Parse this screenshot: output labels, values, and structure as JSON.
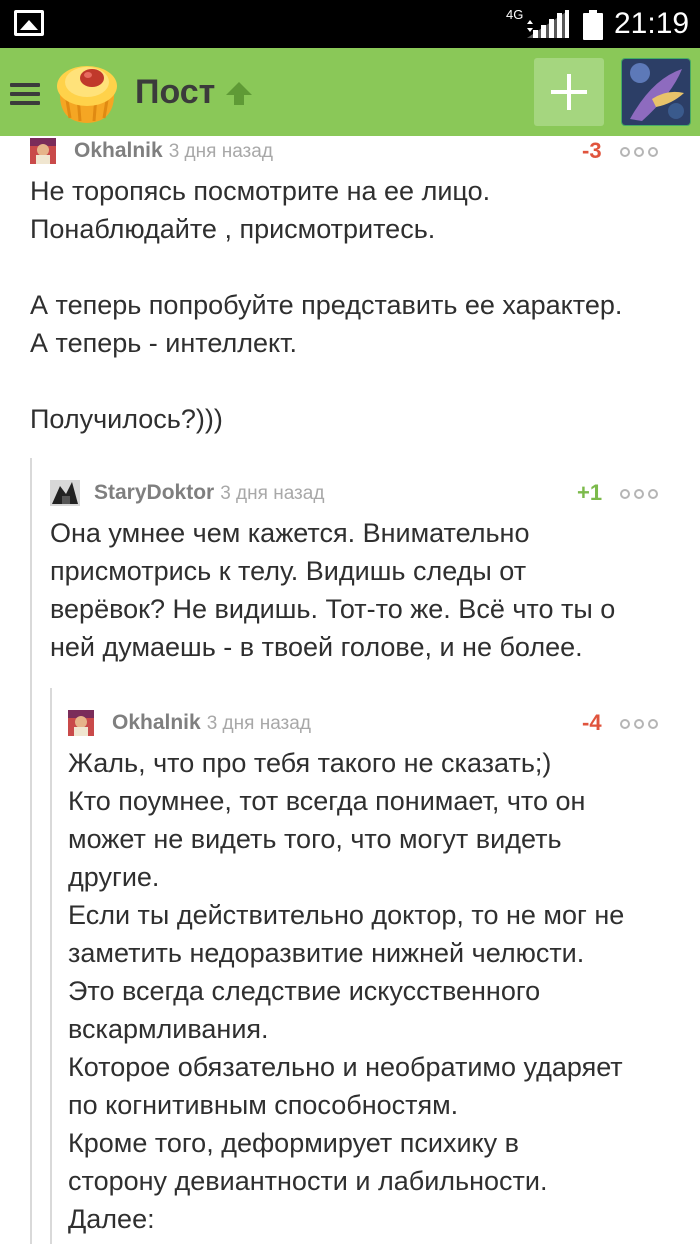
{
  "status_bar": {
    "network": "4G",
    "time": "21:19"
  },
  "app_bar": {
    "title": "Пост",
    "colors": {
      "bar": "#8ac858",
      "title": "#3b3b3b"
    },
    "icons": [
      "menu-icon",
      "logo-icon",
      "arrow-up-icon",
      "plus-icon",
      "user-avatar"
    ]
  },
  "comments": [
    {
      "author": "Okhalnik",
      "time": "3 дня назад",
      "rating": "-3",
      "text": "Не торопясь посмотрите на ее лицо.\nПонаблюдайте , присмотритесь.\n\nА теперь попробуйте представить ее характер.\nА теперь - интеллект.\n\nПолучилось?)))"
    },
    {
      "author": "StaryDoktor",
      "time": "3 дня назад",
      "rating": "+1",
      "text": "Она умнее чем кажется. Внимательно\nприсмотрись к телу. Видишь следы от\nверёвок? Не видишь. Тот-то же. Всё что ты о\nней думаешь - в твоей голове, и не более."
    },
    {
      "author": "Okhalnik",
      "time": "3 дня назад",
      "rating": "-4",
      "text": "Жаль, что про тебя такого не сказать;)\nКто поумнее, тот всегда понимает, что он\nможет не видеть того, что могут видеть\nдругие.\nЕсли ты действительно доктор, то не мог не\nзаметить недоразвитие нижней челюсти.\nЭто всегда следствие искусственного\nвскармливания.\nКоторое обязательно и необратимо ударяет\nпо когнитивным способностям.\nКроме того, деформирует психику в\nсторону девиантности и лабильности.\nДалее:"
    }
  ]
}
